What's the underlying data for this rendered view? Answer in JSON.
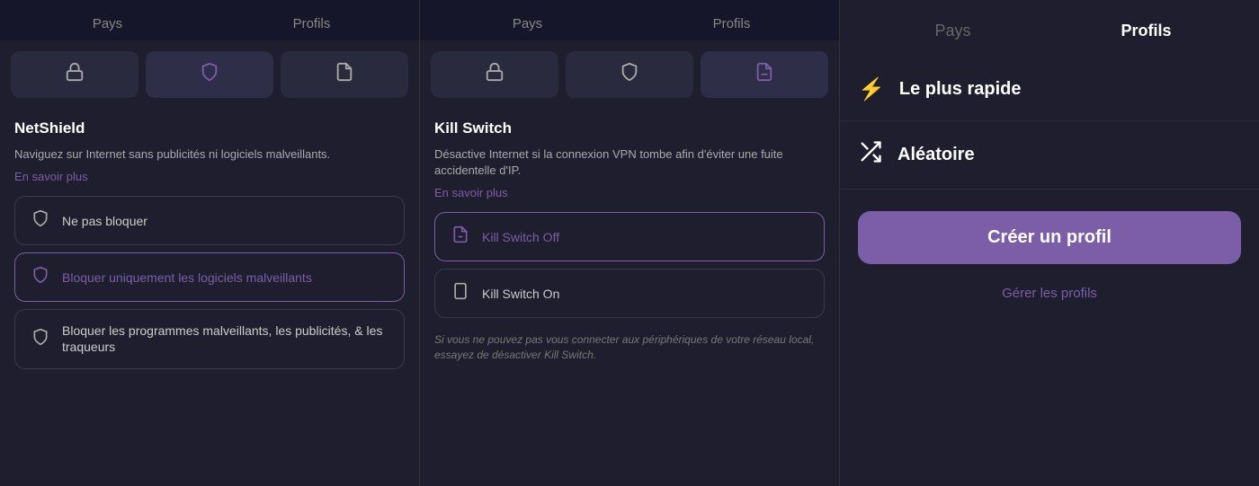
{
  "panel1": {
    "tabs": [
      {
        "id": "pays",
        "label": "Pays",
        "active": false
      },
      {
        "id": "profils",
        "label": "Profils",
        "active": false
      }
    ],
    "icons": [
      {
        "id": "lock",
        "symbol": "🔒",
        "active": false
      },
      {
        "id": "shield",
        "symbol": "🛡",
        "active": true
      },
      {
        "id": "page",
        "symbol": "📋",
        "active": false
      }
    ],
    "title": "NetShield",
    "description": "Naviguez sur Internet sans publicités ni logiciels malveillants.",
    "learn_more": "En savoir plus",
    "options": [
      {
        "id": "no-block",
        "icon": "🛡",
        "text": "Ne pas bloquer",
        "selected": false
      },
      {
        "id": "block-malware",
        "icon": "🛡",
        "text": "Bloquer uniquement les logiciels malveillants",
        "selected": true
      },
      {
        "id": "block-all",
        "icon": "🛡",
        "text": "Bloquer les programmes malveillants, les publicités, & les traqueurs",
        "selected": false
      }
    ]
  },
  "panel2": {
    "tabs": [
      {
        "id": "pays",
        "label": "Pays",
        "active": false
      },
      {
        "id": "profils",
        "label": "Profils",
        "active": false
      }
    ],
    "icons": [
      {
        "id": "lock",
        "symbol": "🔒",
        "active": false
      },
      {
        "id": "shield",
        "symbol": "🛡",
        "active": false
      },
      {
        "id": "page",
        "symbol": "📋",
        "active": true
      }
    ],
    "title": "Kill Switch",
    "description": "Désactive Internet si la connexion VPN tombe afin d'éviter une fuite accidentelle d'IP.",
    "learn_more": "En savoir plus",
    "options": [
      {
        "id": "switch-off",
        "icon": "📋",
        "text": "Kill Switch Off",
        "selected": true
      },
      {
        "id": "switch-on",
        "icon": "📱",
        "text": "Kill Switch On",
        "selected": false
      }
    ],
    "footnote": "Si vous ne pouvez pas vous connecter aux périphériques de votre réseau local, essayez de désactiver Kill Switch."
  },
  "panel3": {
    "tabs": [
      {
        "id": "pays",
        "label": "Pays",
        "active": false
      },
      {
        "id": "profils",
        "label": "Profils",
        "active": true
      }
    ],
    "profiles": [
      {
        "id": "fastest",
        "icon": "⚡",
        "label": "Le plus rapide"
      },
      {
        "id": "random",
        "icon": "⇄",
        "label": "Aléatoire"
      }
    ],
    "create_button": "Créer un profil",
    "manage_link": "Gérer les profils"
  }
}
